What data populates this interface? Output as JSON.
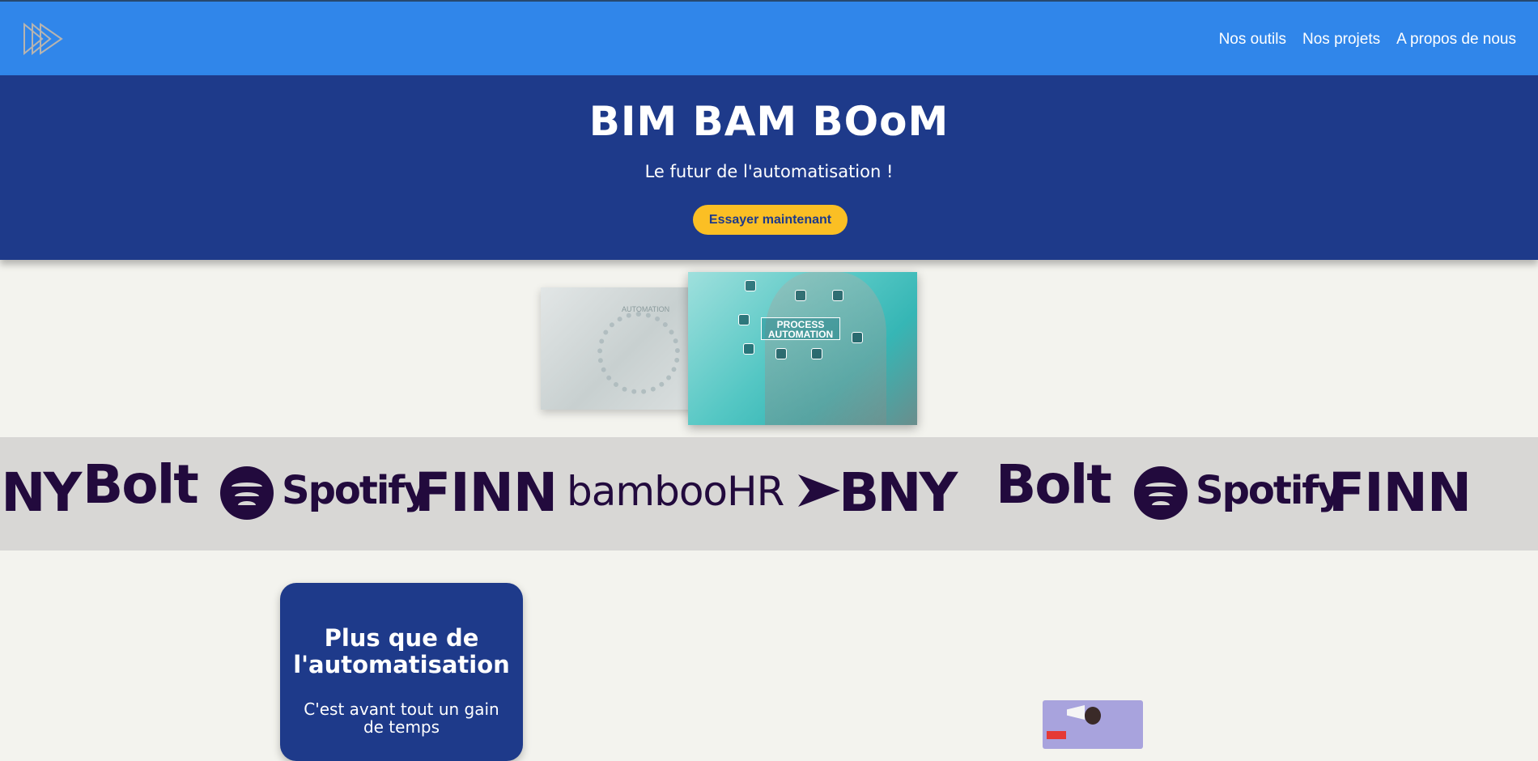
{
  "nav": {
    "links": [
      "Nos outils",
      "Nos projets",
      "A propos de nous"
    ]
  },
  "hero": {
    "title": "BIM BAM BOoM",
    "tagline": "Le futur de l'automatisation !",
    "cta_label": "Essayer maintenant"
  },
  "images": {
    "back_label": "AUTOMATION",
    "front_label_line1": "PROCESS",
    "front_label_line2": "AUTOMATION"
  },
  "brands": [
    "BNY",
    "Bolt",
    "Spotify",
    "FINN",
    "bambooHR",
    "BNY",
    "Bolt",
    "Spotify",
    "FINN"
  ],
  "card": {
    "title": "Plus que de l'automatisation",
    "text": "C'est avant tout un gain de temps"
  },
  "colors": {
    "topbar": "#3086ea",
    "hero": "#1e3a8a",
    "cta": "#fbbf24",
    "brand": "#220a3d",
    "band": "#d8d7d5",
    "page": "#f3f3ee"
  }
}
